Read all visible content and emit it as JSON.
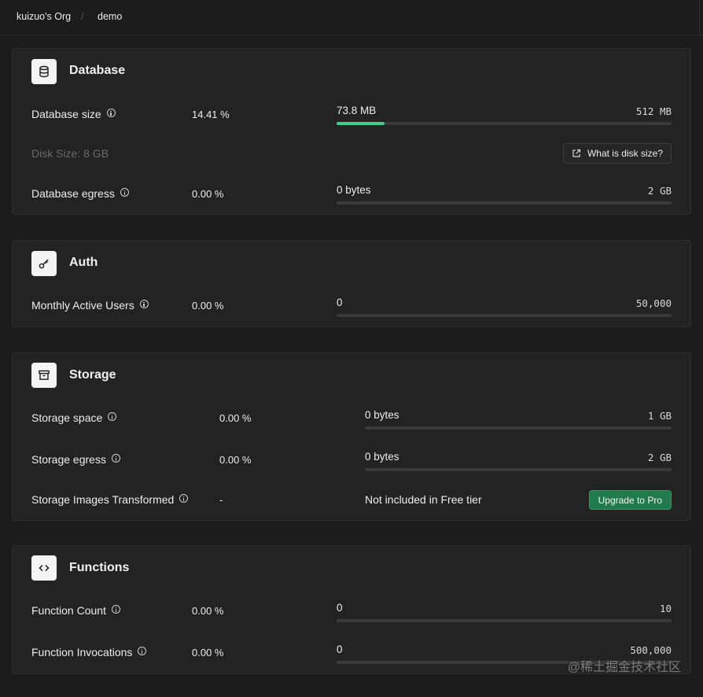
{
  "breadcrumb": {
    "org": "kuizuo's Org",
    "separator": "/",
    "project": "demo"
  },
  "database": {
    "title": "Database",
    "size": {
      "label": "Database size",
      "percent": "14.41 %",
      "used": "73.8 MB",
      "limit": "512  MB",
      "usage_fraction": 0.1441
    },
    "disk": {
      "label": "Disk Size: 8 GB",
      "button": "What is disk size?"
    },
    "egress": {
      "label": "Database egress",
      "percent": "0.00 %",
      "used": "0 bytes",
      "limit": "2  GB",
      "usage_fraction": 0
    }
  },
  "auth": {
    "title": "Auth",
    "mau": {
      "label": "Monthly Active Users",
      "percent": "0.00 %",
      "used": "0",
      "limit": "50,000",
      "usage_fraction": 0
    }
  },
  "storage": {
    "title": "Storage",
    "space": {
      "label": "Storage space",
      "percent": "0.00 %",
      "used": "0 bytes",
      "limit": "1  GB",
      "usage_fraction": 0
    },
    "egress": {
      "label": "Storage egress",
      "percent": "0.00 %",
      "used": "0 bytes",
      "limit": "2  GB",
      "usage_fraction": 0
    },
    "images": {
      "label": "Storage Images Transformed",
      "percent": "-",
      "note": "Not included in Free tier",
      "button": "Upgrade to Pro"
    }
  },
  "functions": {
    "title": "Functions",
    "count": {
      "label": "Function Count",
      "percent": "0.00 %",
      "used": "0",
      "limit": "10",
      "usage_fraction": 0
    },
    "invocations": {
      "label": "Function Invocations",
      "percent": "0.00 %",
      "used": "0",
      "limit": "500,000",
      "usage_fraction": 0
    }
  },
  "watermark": "@稀土掘金技术社区",
  "colors": {
    "accent": "#3ecf8e",
    "upgrade": "#1f7a4c"
  },
  "icons": [
    "database-icon",
    "key-icon",
    "archive-icon",
    "code-icon",
    "info-icon",
    "external-link-icon"
  ]
}
